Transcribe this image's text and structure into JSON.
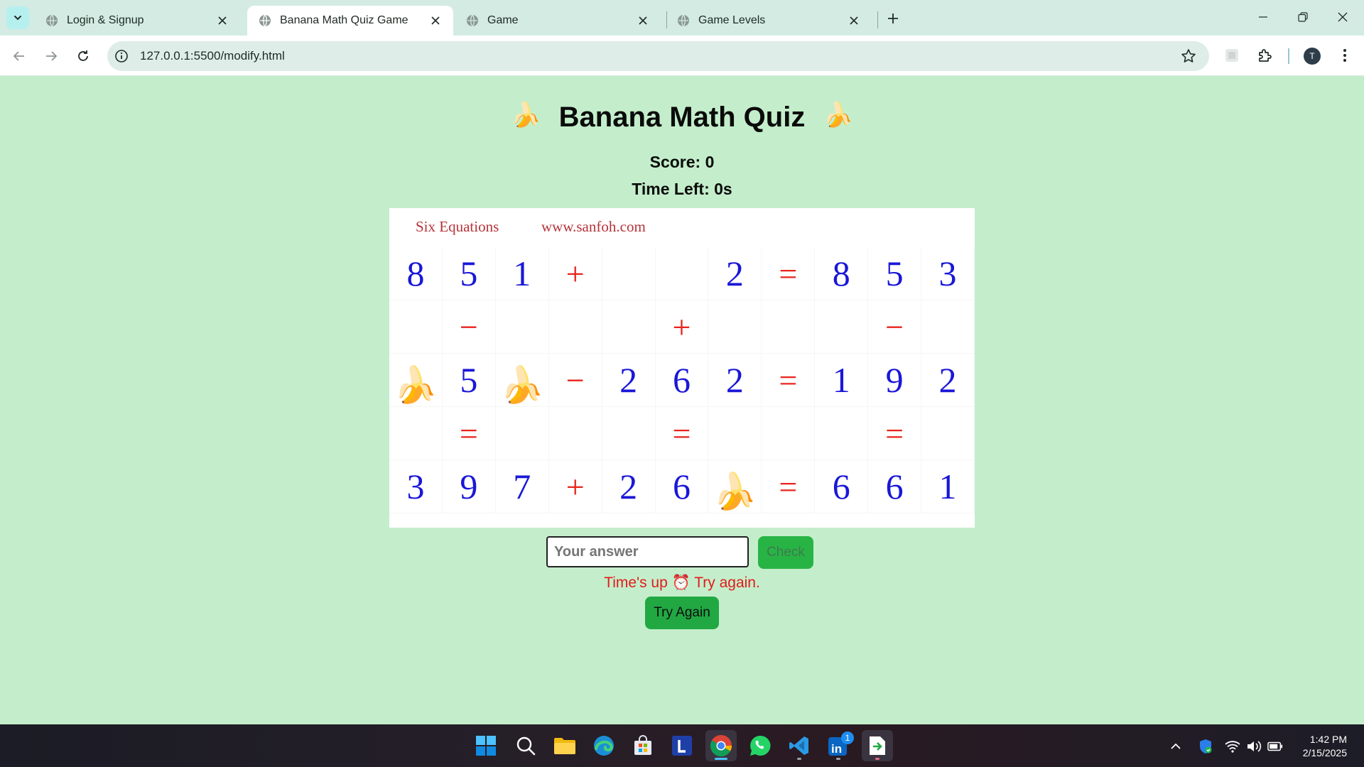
{
  "browser": {
    "tabs": [
      {
        "title": "Login & Signup",
        "active": false
      },
      {
        "title": "Banana Math Quiz Game",
        "active": true
      },
      {
        "title": "Game",
        "active": false
      },
      {
        "title": "Game Levels",
        "active": false
      }
    ],
    "url": "127.0.0.1:5500/modify.html",
    "profile_initial": "T"
  },
  "page": {
    "title": "Banana Math Quiz",
    "title_emoji": "🍌",
    "score_text": "Score: 0",
    "time_left_text": "Time Left: 0s",
    "puzzle": {
      "header_left": "Six Equations",
      "header_right": "www.sanfoh.com",
      "rows": [
        [
          "8",
          "5",
          "1",
          "+",
          "",
          "",
          "2",
          "=",
          "8",
          "5",
          "3"
        ],
        [
          "",
          "−",
          "",
          "",
          "",
          "+",
          "",
          "",
          "",
          "−",
          ""
        ],
        [
          "🍌",
          "5",
          "🍌",
          "−",
          "2",
          "6",
          "2",
          "=",
          "1",
          "9",
          "2"
        ],
        [
          "",
          "=",
          "",
          "",
          "",
          "=",
          "",
          "",
          "",
          "=",
          ""
        ],
        [
          "3",
          "9",
          "7",
          "+",
          "2",
          "6",
          "🍌",
          "=",
          "6",
          "6",
          "1"
        ]
      ]
    },
    "answer_placeholder": "Your answer",
    "check_label": "Check",
    "status_text": "Time's up ⏰ Try again.",
    "try_again_label": "Try Again"
  },
  "colors": {
    "page_bg": "#c4eecb",
    "number": "#1a17d8",
    "operator": "#e8241c",
    "button_green": "#21a843",
    "status_red": "#e31a1a"
  },
  "taskbar": {
    "apps": [
      "windows-start",
      "search",
      "file-explorer",
      "edge",
      "microsoft-store",
      "l-app",
      "chrome",
      "whatsapp",
      "vscode",
      "linkedin",
      "file-app"
    ],
    "linkedin_badge": "1",
    "time": "1:42 PM",
    "date": "2/15/2025"
  }
}
